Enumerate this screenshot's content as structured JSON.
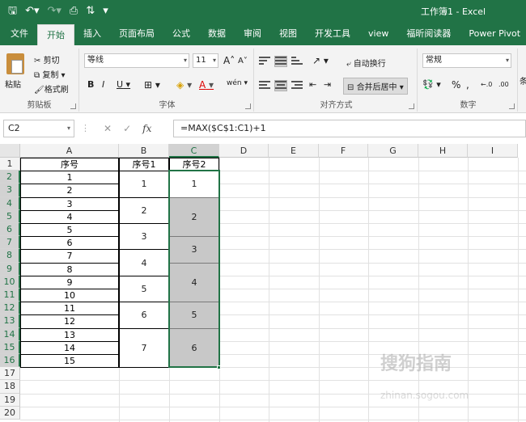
{
  "window": {
    "title": "工作簿1 - Excel",
    "qat": [
      "save-icon",
      "undo-icon",
      "redo-icon",
      "print-preview-icon",
      "sort-icon",
      "customize-icon"
    ]
  },
  "tabs": [
    "文件",
    "开始",
    "插入",
    "页面布局",
    "公式",
    "数据",
    "审阅",
    "视图",
    "开发工具",
    "view",
    "福昕阅读器",
    "Power Pivot"
  ],
  "active_tab": "开始",
  "ribbon": {
    "clipboard": {
      "paste": "粘贴",
      "cut": "剪切",
      "copy": "复制",
      "format_painter": "格式刷",
      "label": "剪贴板"
    },
    "font": {
      "name": "等线",
      "size": "11",
      "bold": "B",
      "italic": "I",
      "underline": "U",
      "label": "字体",
      "grow": "A",
      "shrink": "A",
      "phonetic": "wén"
    },
    "alignment": {
      "wrap": "自动换行",
      "merge": "合并后居中",
      "label": "对齐方式"
    },
    "number": {
      "format": "常规",
      "percent": "%",
      "comma": ",",
      "label": "数字"
    }
  },
  "formula_bar": {
    "name_box": "C2",
    "formula": "=MAX($C$1:C1)+1",
    "fx": "fx"
  },
  "columns": [
    "A",
    "B",
    "C",
    "D",
    "E",
    "F",
    "G",
    "H",
    "I"
  ],
  "selected_column": "C",
  "rows": [
    "1",
    "2",
    "3",
    "4",
    "5",
    "6",
    "7",
    "8",
    "9",
    "10",
    "11",
    "12",
    "13",
    "14",
    "15",
    "16",
    "17",
    "18",
    "19",
    "20"
  ],
  "sheet": {
    "headers": {
      "a": "序号",
      "b": "序号1",
      "c": "序号2"
    },
    "col_a": [
      "1",
      "2",
      "3",
      "4",
      "5",
      "6",
      "7",
      "8",
      "9",
      "10",
      "11",
      "12",
      "13",
      "14",
      "15"
    ],
    "col_b": [
      "1",
      "2",
      "3",
      "4",
      "5",
      "6",
      "7"
    ],
    "col_c": [
      "1",
      "2",
      "3",
      "4",
      "5",
      "6"
    ]
  },
  "watermark": {
    "main": "搜狗指南",
    "sub": "zhinan.sogou.com"
  }
}
